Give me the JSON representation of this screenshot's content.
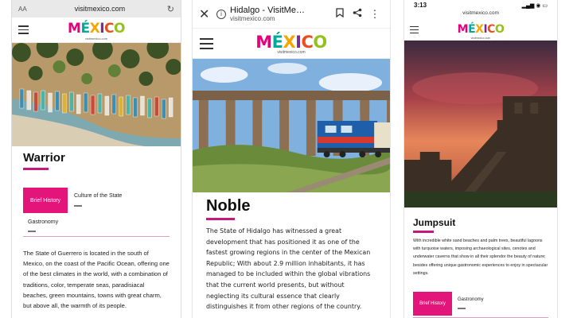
{
  "phone1": {
    "url_bar": {
      "aa": "AA",
      "url": "visitmexico.com",
      "reload_icon": "reload-icon"
    },
    "logo": {
      "word": "MÉXICO",
      "sub": "visitmexico.com"
    },
    "title": "Warrior",
    "tabs": [
      {
        "label": "Brief History",
        "active": true
      },
      {
        "label": "Culture of the State",
        "active": false
      },
      {
        "label": "Gastronomy",
        "active": false
      }
    ],
    "body": "The State of Guerrero is located in the south of Mexico, on the coast of the Pacific Ocean, offering one of the best climates in the world, with a combination of traditions, color, temperate seas, paradisiacal beaches, green mountains, towns with great charm, but above all, the warmth of its people."
  },
  "phone2": {
    "chrome": {
      "title": "Hidalgo - VisitMe…",
      "url": "visitmexico.com",
      "close_icon": "close-icon",
      "info_icon": "info-icon",
      "bookmark_icon": "bookmark-icon",
      "share_icon": "share-icon",
      "menu_icon": "more-vert-icon"
    },
    "logo": {
      "word": "MÉXICO",
      "sub": "visitmexico.com"
    },
    "title": "Noble",
    "body": "The State of Hidalgo has witnessed a great development that has positioned it as one of the fastest growing regions in the center of the Mexican Republic; With about 2.9 million inhabitants, it has managed to be included within the global vibrations that the current world presents, but without neglecting its cultural essence that clearly distinguishes it from other regions of the country."
  },
  "phone3": {
    "status": {
      "time": "3:13",
      "icons": "▂▄▆ ◉ ▭"
    },
    "url": "visitmexico.com",
    "logo": {
      "word": "MÉXICO",
      "sub": "visitmexico.com"
    },
    "title": "Jumpsuit",
    "body": "With incredible white sand beaches and palm trees, beautiful lagoons with turquoise waters, imposing archaeological sites, cenotes and underwater caverns that show in all their splendor the beauty of nature; besides offering unique gastronomic experiences to enjoy in spectacular settings.",
    "tabs": [
      {
        "label": "Brief History",
        "active": true
      },
      {
        "label": "Gastronomy",
        "active": false
      }
    ]
  },
  "colors": {
    "accent": "#e3157a",
    "underline": "#c8177a"
  }
}
